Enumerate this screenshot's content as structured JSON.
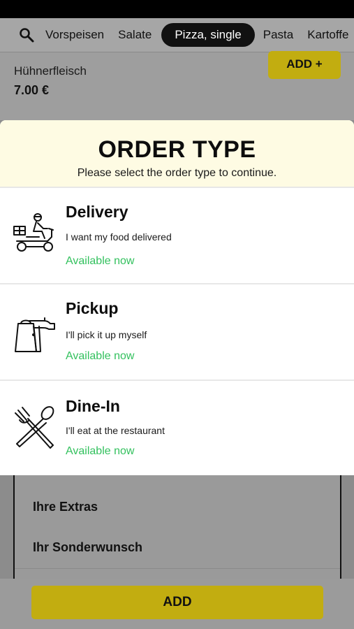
{
  "categories": {
    "items": [
      "Vorspeisen",
      "Salate",
      "Pizza, single",
      "Pasta",
      "Kartoffe"
    ],
    "active": "Pizza, single"
  },
  "icons": {
    "search": "search-icon",
    "delivery": "scooter-delivery-icon",
    "pickup": "pickup-bag-icon",
    "dinein": "fork-spoon-icon"
  },
  "background_product": {
    "name": "Hühnerfleisch",
    "price": "7.00 €",
    "add_label": "ADD +"
  },
  "modal": {
    "title": "ORDER TYPE",
    "subtitle": "Please select the order type to continue.",
    "options": [
      {
        "title": "Delivery",
        "description": "I want my food delivered",
        "status": "Available now"
      },
      {
        "title": "Pickup",
        "description": "I'll pick it up myself",
        "status": "Available now"
      },
      {
        "title": "Dine-In",
        "description": "I'll eat at the restaurant",
        "status": "Available now"
      }
    ]
  },
  "background_sheet": {
    "extras": "Ihre Extras",
    "special_request": "Ihr Sonderwunsch",
    "add_label": "ADD"
  },
  "colors": {
    "accent_yellow": "#c2ad10",
    "available_green": "#33c15e",
    "modal_header_bg": "#fefbe3",
    "active_pill": "#111111"
  }
}
